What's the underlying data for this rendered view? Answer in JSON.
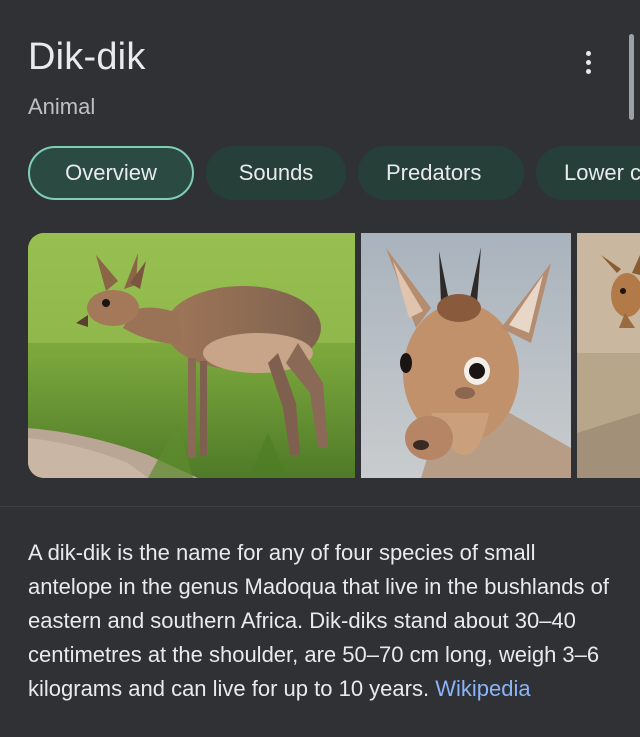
{
  "header": {
    "title": "Dik-dik",
    "subtitle": "Animal",
    "more_icon": "more-vertical-icon"
  },
  "chips": [
    {
      "label": "Overview",
      "active": true
    },
    {
      "label": "Sounds",
      "active": false
    },
    {
      "label": "Predators",
      "active": false
    },
    {
      "label": "Lower c",
      "active": false
    }
  ],
  "images": [
    {
      "subject": "dik-dik standing in grass"
    },
    {
      "subject": "dik-dik head close-up"
    },
    {
      "subject": "dik-dik partial"
    }
  ],
  "description": {
    "text": "A dik-dik is the name for any of four species of small antelope in the genus Madoqua that live in the bushlands of eastern and southern Africa. Dik-diks stand about 30–40 centimetres at the shoulder, are 50–70 cm long, weigh 3–6 kilograms and can live for up to 10 years.",
    "source_link": "Wikipedia"
  },
  "colors": {
    "background": "#303134",
    "chip_bg": "#263f38",
    "chip_active_border": "#7fcfb5",
    "link": "#8ab4f8"
  }
}
